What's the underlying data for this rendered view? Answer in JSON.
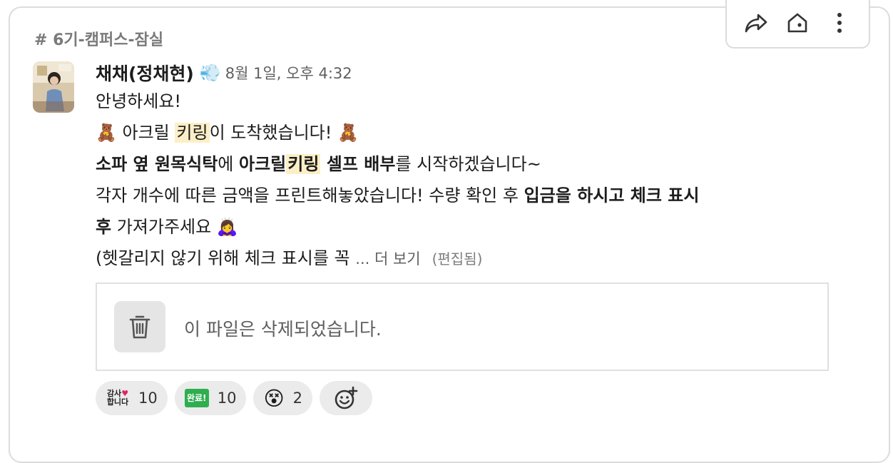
{
  "channel": {
    "name": "# 6기-캠퍼스-잠실"
  },
  "message": {
    "author": "채채(정채현)",
    "status_emoji": "💨",
    "timestamp": "8월 1일, 오후 4:32",
    "lines": {
      "l1": "안녕하세요!",
      "l2_emoji_a": "🧸",
      "l2_a": " 아크릴 ",
      "l2_hl": "키링",
      "l2_b": "이 도착했습니다! ",
      "l2_emoji_b": "🧸",
      "l3_bold_a": "소파 옆 원목식탁",
      "l3_a": "에 ",
      "l3_bold_b": "아크릴",
      "l3_hl": "키링",
      "l3_bold_c": " 셀프 배부",
      "l3_b": "를 시작하겠습니다~",
      "l4_a": "각자 개수에 따른 금액을 프린트해놓았습니다! 수량 확인 후 ",
      "l4_bold": "입금을 하시고 체크 표시",
      "l5_bold": "후",
      "l5_a": " 가져가주세요 ",
      "l5_emoji": "🙇‍♀️",
      "l6_a": "(헷갈리지 않기 위해 체크 표시를 꼭 ",
      "l6_more": "... 더 보기",
      "l6_edited": "(편집됨)"
    }
  },
  "attachment": {
    "deleted_text": "이 파일은 삭제되었습니다."
  },
  "reactions": [
    {
      "emoji_text_top": "감사",
      "emoji_heart": "♥",
      "emoji_text_bottom": "합니다",
      "count": "10"
    },
    {
      "emoji_text": "완료!",
      "count": "10"
    },
    {
      "emoji": "😵",
      "count": "2"
    }
  ],
  "toolbar": {
    "icons": [
      "share-icon",
      "channel-home-icon",
      "more-vertical-icon"
    ]
  },
  "colors": {
    "highlight": "#fcefc7",
    "timestamp": "#616061",
    "done_green": "#2fae4f"
  }
}
